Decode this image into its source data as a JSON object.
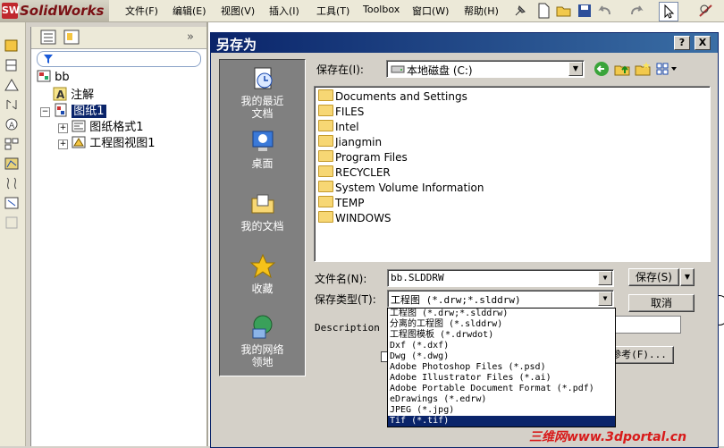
{
  "app": {
    "name": "SolidWorks",
    "logo_mark": "SW"
  },
  "menubar": {
    "items": [
      "文件(F)",
      "编辑(E)",
      "视图(V)",
      "插入(I)",
      "工具(T)",
      "Toolbox",
      "窗口(W)",
      "帮助(H)"
    ]
  },
  "tree": {
    "root": "bb",
    "annotations": "注解",
    "sheet": "图纸1",
    "sheet_format": "图纸格式1",
    "drawing_view": "工程图视图1"
  },
  "dialog": {
    "title": "另存为",
    "help_btn": "?",
    "close_btn": "X",
    "save_in_label": "保存在(I):",
    "save_in_value": "本地磁盘 (C:)",
    "places": [
      "我的最近文档",
      "桌面",
      "我的文档",
      "收藏",
      "我的网络邻地"
    ],
    "places_lines": [
      [
        "我的最近",
        "文档"
      ],
      [
        "桌面"
      ],
      [
        "我的文档"
      ],
      [
        "收藏"
      ],
      [
        "我的网络",
        "领地"
      ]
    ],
    "folders": [
      "Documents and Settings",
      "FILES",
      "Intel",
      "Jiangmin",
      "Program Files",
      "RECYCLER",
      "System Volume Information",
      "TEMP",
      "WINDOWS"
    ],
    "filename_label": "文件名(N):",
    "filename_value": "bb.SLDDRW",
    "filetype_label": "保存类型(T):",
    "filetype_value": "工程图 (*.drw;*.slddrw)",
    "description_label": "Description",
    "save_btn": "保存(S)",
    "cancel_btn": "取消",
    "refs_btn": "参考(F)...",
    "filetype_options": [
      "工程图 (*.drw;*.slddrw)",
      "分离的工程图 (*.slddrw)",
      "工程图模板 (*.drwdot)",
      "Dxf (*.dxf)",
      "Dwg (*.dwg)",
      "Adobe Photoshop Files (*.psd)",
      "Adobe Illustrator Files (*.ai)",
      "Adobe Portable Document Format (*.pdf)",
      "eDrawings (*.edrw)",
      "JPEG (*.jpg)",
      "Tif (*.tif)"
    ],
    "selected_option_index": 10
  },
  "watermark": "三维网www.3dportal.cn",
  "colors": {
    "title_bar": "#0a246a",
    "selection": "#0a246a",
    "places_bg": "#808080",
    "folder": "#f7d774",
    "watermark": "#d81a1a"
  }
}
